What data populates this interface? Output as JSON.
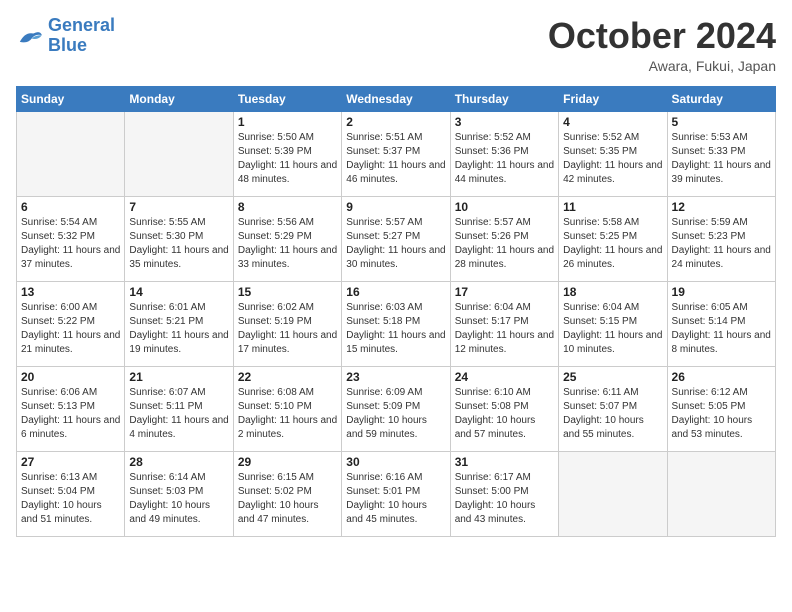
{
  "header": {
    "logo_general": "General",
    "logo_blue": "Blue",
    "month_title": "October 2024",
    "location": "Awara, Fukui, Japan"
  },
  "days_of_week": [
    "Sunday",
    "Monday",
    "Tuesday",
    "Wednesday",
    "Thursday",
    "Friday",
    "Saturday"
  ],
  "weeks": [
    [
      {
        "day": "",
        "empty": true
      },
      {
        "day": "",
        "empty": true
      },
      {
        "day": "1",
        "sunrise": "5:50 AM",
        "sunset": "5:39 PM",
        "daylight": "11 hours and 48 minutes."
      },
      {
        "day": "2",
        "sunrise": "5:51 AM",
        "sunset": "5:37 PM",
        "daylight": "11 hours and 46 minutes."
      },
      {
        "day": "3",
        "sunrise": "5:52 AM",
        "sunset": "5:36 PM",
        "daylight": "11 hours and 44 minutes."
      },
      {
        "day": "4",
        "sunrise": "5:52 AM",
        "sunset": "5:35 PM",
        "daylight": "11 hours and 42 minutes."
      },
      {
        "day": "5",
        "sunrise": "5:53 AM",
        "sunset": "5:33 PM",
        "daylight": "11 hours and 39 minutes."
      }
    ],
    [
      {
        "day": "6",
        "sunrise": "5:54 AM",
        "sunset": "5:32 PM",
        "daylight": "11 hours and 37 minutes."
      },
      {
        "day": "7",
        "sunrise": "5:55 AM",
        "sunset": "5:30 PM",
        "daylight": "11 hours and 35 minutes."
      },
      {
        "day": "8",
        "sunrise": "5:56 AM",
        "sunset": "5:29 PM",
        "daylight": "11 hours and 33 minutes."
      },
      {
        "day": "9",
        "sunrise": "5:57 AM",
        "sunset": "5:27 PM",
        "daylight": "11 hours and 30 minutes."
      },
      {
        "day": "10",
        "sunrise": "5:57 AM",
        "sunset": "5:26 PM",
        "daylight": "11 hours and 28 minutes."
      },
      {
        "day": "11",
        "sunrise": "5:58 AM",
        "sunset": "5:25 PM",
        "daylight": "11 hours and 26 minutes."
      },
      {
        "day": "12",
        "sunrise": "5:59 AM",
        "sunset": "5:23 PM",
        "daylight": "11 hours and 24 minutes."
      }
    ],
    [
      {
        "day": "13",
        "sunrise": "6:00 AM",
        "sunset": "5:22 PM",
        "daylight": "11 hours and 21 minutes."
      },
      {
        "day": "14",
        "sunrise": "6:01 AM",
        "sunset": "5:21 PM",
        "daylight": "11 hours and 19 minutes."
      },
      {
        "day": "15",
        "sunrise": "6:02 AM",
        "sunset": "5:19 PM",
        "daylight": "11 hours and 17 minutes."
      },
      {
        "day": "16",
        "sunrise": "6:03 AM",
        "sunset": "5:18 PM",
        "daylight": "11 hours and 15 minutes."
      },
      {
        "day": "17",
        "sunrise": "6:04 AM",
        "sunset": "5:17 PM",
        "daylight": "11 hours and 12 minutes."
      },
      {
        "day": "18",
        "sunrise": "6:04 AM",
        "sunset": "5:15 PM",
        "daylight": "11 hours and 10 minutes."
      },
      {
        "day": "19",
        "sunrise": "6:05 AM",
        "sunset": "5:14 PM",
        "daylight": "11 hours and 8 minutes."
      }
    ],
    [
      {
        "day": "20",
        "sunrise": "6:06 AM",
        "sunset": "5:13 PM",
        "daylight": "11 hours and 6 minutes."
      },
      {
        "day": "21",
        "sunrise": "6:07 AM",
        "sunset": "5:11 PM",
        "daylight": "11 hours and 4 minutes."
      },
      {
        "day": "22",
        "sunrise": "6:08 AM",
        "sunset": "5:10 PM",
        "daylight": "11 hours and 2 minutes."
      },
      {
        "day": "23",
        "sunrise": "6:09 AM",
        "sunset": "5:09 PM",
        "daylight": "10 hours and 59 minutes."
      },
      {
        "day": "24",
        "sunrise": "6:10 AM",
        "sunset": "5:08 PM",
        "daylight": "10 hours and 57 minutes."
      },
      {
        "day": "25",
        "sunrise": "6:11 AM",
        "sunset": "5:07 PM",
        "daylight": "10 hours and 55 minutes."
      },
      {
        "day": "26",
        "sunrise": "6:12 AM",
        "sunset": "5:05 PM",
        "daylight": "10 hours and 53 minutes."
      }
    ],
    [
      {
        "day": "27",
        "sunrise": "6:13 AM",
        "sunset": "5:04 PM",
        "daylight": "10 hours and 51 minutes."
      },
      {
        "day": "28",
        "sunrise": "6:14 AM",
        "sunset": "5:03 PM",
        "daylight": "10 hours and 49 minutes."
      },
      {
        "day": "29",
        "sunrise": "6:15 AM",
        "sunset": "5:02 PM",
        "daylight": "10 hours and 47 minutes."
      },
      {
        "day": "30",
        "sunrise": "6:16 AM",
        "sunset": "5:01 PM",
        "daylight": "10 hours and 45 minutes."
      },
      {
        "day": "31",
        "sunrise": "6:17 AM",
        "sunset": "5:00 PM",
        "daylight": "10 hours and 43 minutes."
      },
      {
        "day": "",
        "empty": true
      },
      {
        "day": "",
        "empty": true
      }
    ]
  ]
}
